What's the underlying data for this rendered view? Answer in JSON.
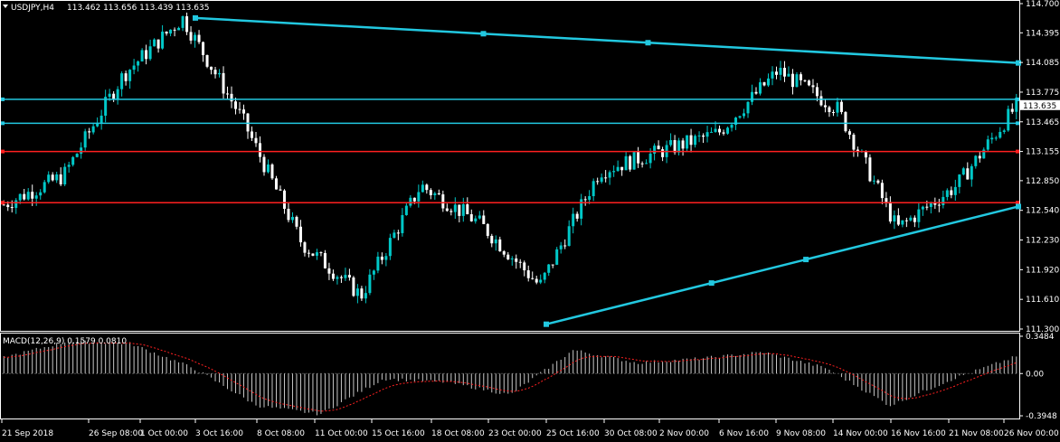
{
  "chart_data": [
    {
      "type": "candlestick",
      "title": "USDJPY,H4",
      "ohlc_readout": "113.462 113.656 113.439 113.635",
      "current_price": "113.635",
      "colors": {
        "bull": "#00c8c8",
        "bear": "#ffffff",
        "trendline": "#22c8e0",
        "level_cyan": "#22c8e0",
        "level_red": "#ff2020",
        "background": "#000000"
      },
      "ylim": [
        111.3,
        114.7
      ],
      "y_ticks": [
        "114.700",
        "114.395",
        "114.085",
        "113.775",
        "113.465",
        "113.155",
        "112.850",
        "112.540",
        "112.230",
        "111.920",
        "111.610",
        "111.300"
      ],
      "x_labels": [
        "21 Sep 2018",
        "26 Sep 08:00",
        "1 Oct 00:00",
        "3 Oct 16:00",
        "8 Oct 08:00",
        "11 Oct 00:00",
        "15 Oct 16:00",
        "18 Oct 08:00",
        "23 Oct 00:00",
        "25 Oct 16:00",
        "30 Oct 08:00",
        "2 Nov 00:00",
        "6 Nov 16:00",
        "9 Nov 08:00",
        "14 Nov 00:00",
        "16 Nov 16:00",
        "21 Nov 08:00",
        "26 Nov 00:00"
      ],
      "key_points": [
        {
          "label": "21 Sep",
          "price": 112.6
        },
        {
          "label": "26 Sep",
          "price": 112.9
        },
        {
          "label": "1 Oct",
          "price": 113.95
        },
        {
          "label": "3 Oct",
          "price": 114.55
        },
        {
          "label": "8 Oct",
          "price": 113.5
        },
        {
          "label": "11 Oct",
          "price": 112.2
        },
        {
          "label": "15 Oct",
          "price": 111.65
        },
        {
          "label": "18 Oct",
          "price": 112.8
        },
        {
          "label": "23 Oct",
          "price": 112.4
        },
        {
          "label": "25 Oct",
          "price": 111.75
        },
        {
          "label": "30 Oct",
          "price": 112.95
        },
        {
          "label": "2 Nov",
          "price": 113.15
        },
        {
          "label": "6 Nov",
          "price": 113.35
        },
        {
          "label": "9 Nov",
          "price": 114.0
        },
        {
          "label": "14 Nov",
          "price": 113.6
        },
        {
          "label": "16 Nov",
          "price": 112.35
        },
        {
          "label": "21 Nov",
          "price": 112.8
        },
        {
          "label": "26 Nov",
          "price": 113.63
        }
      ],
      "horizontal_levels": [
        {
          "price": 113.7,
          "color": "cyan"
        },
        {
          "price": 113.45,
          "color": "cyan"
        },
        {
          "price": 113.155,
          "color": "red"
        },
        {
          "price": 112.62,
          "color": "red"
        }
      ],
      "trendlines": [
        {
          "from": {
            "label": "3 Oct",
            "price": 114.55
          },
          "to": {
            "label": "26 Nov",
            "price": 114.08
          },
          "color": "cyan"
        },
        {
          "from": {
            "label": "25 Oct",
            "price": 111.35
          },
          "to": {
            "label": "26 Nov",
            "price": 112.58
          },
          "color": "cyan"
        }
      ]
    },
    {
      "type": "histogram",
      "title": "MACD(12,26,9) 0.1579 0.0810",
      "ylim": [
        -0.3948,
        0.3484
      ],
      "y_ticks": [
        "0.3484",
        "0.00",
        "-0.3948"
      ],
      "signal_color": "#ff2020",
      "bar_color": "#c8c8c8",
      "key_points": [
        {
          "label": "21 Sep",
          "value": 0.15
        },
        {
          "label": "1 Oct",
          "value": 0.3
        },
        {
          "label": "3 Oct",
          "value": 0.28
        },
        {
          "label": "8 Oct",
          "value": 0.05
        },
        {
          "label": "11 Oct",
          "value": -0.3
        },
        {
          "label": "15 Oct",
          "value": -0.38
        },
        {
          "label": "18 Oct",
          "value": -0.05
        },
        {
          "label": "23 Oct",
          "value": -0.08
        },
        {
          "label": "25 Oct",
          "value": -0.2
        },
        {
          "label": "30 Oct",
          "value": 0.22
        },
        {
          "label": "2 Nov",
          "value": 0.1
        },
        {
          "label": "6 Nov",
          "value": 0.14
        },
        {
          "label": "9 Nov",
          "value": 0.2
        },
        {
          "label": "14 Nov",
          "value": 0.05
        },
        {
          "label": "16 Nov",
          "value": -0.3
        },
        {
          "label": "21 Nov",
          "value": -0.05
        },
        {
          "label": "26 Nov",
          "value": 0.16
        }
      ]
    }
  ]
}
